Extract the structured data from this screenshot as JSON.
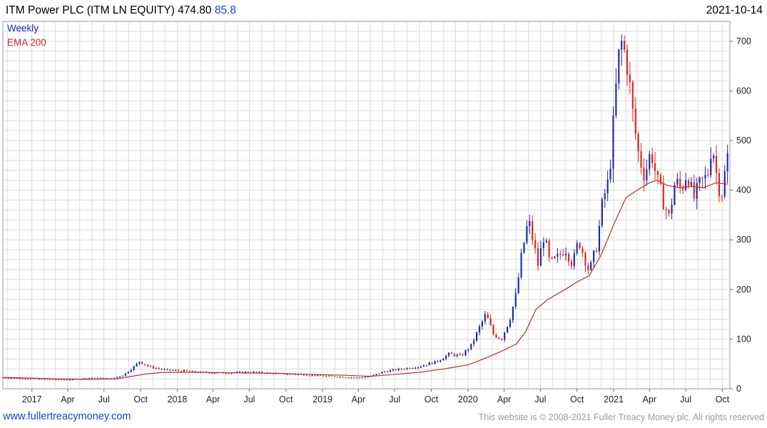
{
  "header": {
    "title": "ITM Power PLC (ITM LN EQUITY) 474.80",
    "change": "85.8",
    "date": "2021-10-14"
  },
  "legend": {
    "weekly": "Weekly",
    "ema": "EMA 200"
  },
  "footer": {
    "website": "www.fullertreacymoney.com",
    "copyright": "This website is © 2008-2021 Fuller Treacy Money plc. All rights reserved"
  },
  "colors": {
    "up": "#1f28a8",
    "down": "#e0251f",
    "ema": "#b8302e",
    "grid": "#dcdcdc"
  },
  "chart_data": {
    "type": "candlestick",
    "frequency": "weekly",
    "ylim": [
      0,
      740
    ],
    "y_ticks": [
      0,
      100,
      200,
      300,
      400,
      500,
      600,
      700
    ],
    "x_range": [
      "2016-10-20",
      "2021-10-20"
    ],
    "x_ticks": [
      {
        "date": "2017-01-01",
        "label": "2017"
      },
      {
        "date": "2017-04-01",
        "label": "Apr"
      },
      {
        "date": "2017-07-01",
        "label": "Jul"
      },
      {
        "date": "2017-10-01",
        "label": "Oct"
      },
      {
        "date": "2018-01-01",
        "label": "2018"
      },
      {
        "date": "2018-04-01",
        "label": "Apr"
      },
      {
        "date": "2018-07-01",
        "label": "Jul"
      },
      {
        "date": "2018-10-01",
        "label": "Oct"
      },
      {
        "date": "2019-01-01",
        "label": "2019"
      },
      {
        "date": "2019-04-01",
        "label": "Apr"
      },
      {
        "date": "2019-07-01",
        "label": "Jul"
      },
      {
        "date": "2019-10-01",
        "label": "Oct"
      },
      {
        "date": "2020-01-01",
        "label": "2020"
      },
      {
        "date": "2020-04-01",
        "label": "Apr"
      },
      {
        "date": "2020-07-01",
        "label": "Jul"
      },
      {
        "date": "2020-10-01",
        "label": "Oct"
      },
      {
        "date": "2021-01-01",
        "label": "2021"
      },
      {
        "date": "2021-04-01",
        "label": "Apr"
      },
      {
        "date": "2021-07-01",
        "label": "Jul"
      },
      {
        "date": "2021-10-01",
        "label": "Oct"
      }
    ],
    "close_path": [
      [
        "2016-10-20",
        22
      ],
      [
        "2017-01-01",
        20
      ],
      [
        "2017-04-01",
        18
      ],
      [
        "2017-06-01",
        22
      ],
      [
        "2017-07-20",
        20
      ],
      [
        "2017-08-20",
        28
      ],
      [
        "2017-09-15",
        45
      ],
      [
        "2017-09-28",
        55
      ],
      [
        "2017-10-20",
        45
      ],
      [
        "2017-12-01",
        38
      ],
      [
        "2018-01-15",
        36
      ],
      [
        "2018-03-01",
        33
      ],
      [
        "2018-05-01",
        32
      ],
      [
        "2018-07-01",
        34
      ],
      [
        "2018-09-01",
        31
      ],
      [
        "2018-11-01",
        29
      ],
      [
        "2019-01-01",
        26
      ],
      [
        "2019-02-15",
        24
      ],
      [
        "2019-04-01",
        22
      ],
      [
        "2019-05-01",
        25
      ],
      [
        "2019-06-01",
        34
      ],
      [
        "2019-07-01",
        38
      ],
      [
        "2019-09-01",
        45
      ],
      [
        "2019-10-15",
        55
      ],
      [
        "2019-11-15",
        70
      ],
      [
        "2019-12-15",
        66
      ],
      [
        "2020-01-10",
        88
      ],
      [
        "2020-01-28",
        120
      ],
      [
        "2020-02-15",
        150
      ],
      [
        "2020-03-05",
        110
      ],
      [
        "2020-03-25",
        100
      ],
      [
        "2020-04-15",
        140
      ],
      [
        "2020-05-01",
        190
      ],
      [
        "2020-05-15",
        270
      ],
      [
        "2020-06-01",
        340
      ],
      [
        "2020-06-12",
        300
      ],
      [
        "2020-06-25",
        250
      ],
      [
        "2020-07-10",
        310
      ],
      [
        "2020-07-25",
        250
      ],
      [
        "2020-08-15",
        265
      ],
      [
        "2020-09-01",
        285
      ],
      [
        "2020-09-20",
        250
      ],
      [
        "2020-10-05",
        300
      ],
      [
        "2020-10-20",
        265
      ],
      [
        "2020-11-01",
        235
      ],
      [
        "2020-11-20",
        290
      ],
      [
        "2020-12-05",
        380
      ],
      [
        "2020-12-20",
        420
      ],
      [
        "2021-01-01",
        540
      ],
      [
        "2021-01-12",
        660
      ],
      [
        "2021-01-22",
        700
      ],
      [
        "2021-02-05",
        650
      ],
      [
        "2021-02-20",
        540
      ],
      [
        "2021-03-05",
        470
      ],
      [
        "2021-03-20",
        430
      ],
      [
        "2021-04-05",
        480
      ],
      [
        "2021-04-20",
        420
      ],
      [
        "2021-05-05",
        380
      ],
      [
        "2021-05-20",
        345
      ],
      [
        "2021-06-05",
        420
      ],
      [
        "2021-06-20",
        400
      ],
      [
        "2021-07-05",
        440
      ],
      [
        "2021-07-20",
        380
      ],
      [
        "2021-08-05",
        410
      ],
      [
        "2021-08-25",
        430
      ],
      [
        "2021-09-05",
        500
      ],
      [
        "2021-09-20",
        410
      ],
      [
        "2021-10-01",
        395
      ],
      [
        "2021-10-14",
        474.8
      ]
    ],
    "ema_200": [
      [
        "2016-10-20",
        23
      ],
      [
        "2017-03-01",
        20
      ],
      [
        "2017-06-01",
        19
      ],
      [
        "2017-08-01",
        20
      ],
      [
        "2017-10-15",
        30
      ],
      [
        "2017-12-01",
        33
      ],
      [
        "2018-03-01",
        33
      ],
      [
        "2018-06-01",
        32
      ],
      [
        "2018-09-01",
        31
      ],
      [
        "2018-12-01",
        29
      ],
      [
        "2019-03-01",
        27
      ],
      [
        "2019-05-01",
        25
      ],
      [
        "2019-07-01",
        29
      ],
      [
        "2019-09-01",
        33
      ],
      [
        "2019-11-01",
        40
      ],
      [
        "2020-01-01",
        48
      ],
      [
        "2020-02-15",
        62
      ],
      [
        "2020-04-01",
        78
      ],
      [
        "2020-05-01",
        90
      ],
      [
        "2020-05-25",
        115
      ],
      [
        "2020-06-20",
        160
      ],
      [
        "2020-07-20",
        180
      ],
      [
        "2020-09-01",
        200
      ],
      [
        "2020-10-01",
        215
      ],
      [
        "2020-11-01",
        228
      ],
      [
        "2020-12-01",
        270
      ],
      [
        "2021-01-01",
        330
      ],
      [
        "2021-02-01",
        385
      ],
      [
        "2021-03-01",
        400
      ],
      [
        "2021-04-01",
        415
      ],
      [
        "2021-04-20",
        420
      ],
      [
        "2021-05-15",
        410
      ],
      [
        "2021-06-15",
        405
      ],
      [
        "2021-07-15",
        408
      ],
      [
        "2021-08-15",
        405
      ],
      [
        "2021-09-15",
        415
      ],
      [
        "2021-10-14",
        412
      ]
    ]
  }
}
